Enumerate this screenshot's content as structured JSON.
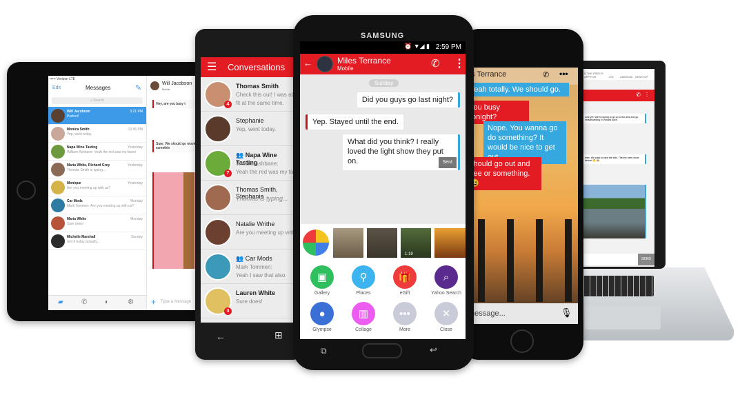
{
  "colors": {
    "brand_red": "#e31b23",
    "tablet_blue": "#3d9ae8",
    "sent_blue": "#35a8e0"
  },
  "tablet": {
    "status": "••••• Verizon  LTE",
    "edit": "Edit",
    "title": "Messages",
    "search_placeholder": "Search",
    "rows": [
      {
        "name": "Will Jacobson",
        "preview": "Perfect!",
        "time": "3:21 PM"
      },
      {
        "name": "Monica Smith",
        "preview": "Yep, went today.",
        "time": "12:45 PM"
      },
      {
        "name": "Napa Wine Tasting",
        "preview": "William Ashbane: Yeah the red was my favorite! From now on...",
        "time": "Yesterday"
      },
      {
        "name": "Maria White, Richard Grey",
        "preview": "Thomas Smith is typing...",
        "time": "Yesterday"
      },
      {
        "name": "Monique",
        "preview": "Are you meeting up with us?",
        "time": "Yesterday"
      },
      {
        "name": "Car Mods",
        "preview": "Mark Tommen: Are you meeting up with us?",
        "time": "Monday"
      },
      {
        "name": "Maria White",
        "preview": "Sure does!",
        "time": "Monday"
      },
      {
        "name": "Michelle Marshall",
        "preview": "Got it today actually...",
        "time": "Sunday"
      }
    ],
    "chat_name": "Will Jacobson",
    "chat_sub": "Mobile",
    "messages": [
      "Hey, are you busy t",
      "Sure. We should go movie or somethin"
    ],
    "input_placeholder": "Type a message"
  },
  "windows_phone": {
    "title": "Conversations",
    "rows": [
      {
        "name": "Thomas Smith",
        "lines": [
          "Check this out! I was able",
          "fit at the same time."
        ],
        "badge": "4",
        "bold": true
      },
      {
        "name": "Stephanie",
        "lines": [
          "Yep, went today."
        ],
        "bold": false
      },
      {
        "name": "Napa Wine Tasting",
        "lines": [
          "William Ashbane:",
          "Yeah the red was my favorite"
        ],
        "badge": "7",
        "bold": true,
        "group": true
      },
      {
        "name": "Thomas Smith, Stephanie",
        "lines": [
          "Thomas is typing..."
        ],
        "bold": false
      },
      {
        "name": "Natalie Writhe",
        "lines": [
          "Are you meeting up with us?"
        ],
        "bold": false
      },
      {
        "name": "Car Mods",
        "lines": [
          "Mark Tommen:",
          "Yeah I saw that also."
        ],
        "bold": false,
        "group": true
      },
      {
        "name": "Lauren White",
        "lines": [
          "Sure does!"
        ],
        "badge": "3",
        "bold": true
      }
    ]
  },
  "samsung": {
    "brand": "SAMSUNG",
    "time": "2:59 PM",
    "contact": "Miles Terrance",
    "contact_sub": "Mobile",
    "day": "Sunday",
    "messages": [
      {
        "dir": "out",
        "text": "Did you guys go last night?"
      },
      {
        "dir": "in",
        "text": "Yep. Stayed until the end."
      },
      {
        "dir": "out",
        "text": "What did you think? I really loved the light show they put on.",
        "status": "Sent"
      }
    ],
    "video_duration": "1:19",
    "actions": [
      {
        "label": "Gallery",
        "color": "#2fbf5f",
        "icon": "image-icon"
      },
      {
        "label": "Places",
        "color": "#3cb4ef",
        "icon": "map-pin-icon"
      },
      {
        "label": "eGift",
        "color": "#ee3b3b",
        "icon": "gift-icon"
      },
      {
        "label": "Yahoo Search",
        "color": "#5b2a8f",
        "icon": "search-icon"
      },
      {
        "label": "Glympse",
        "color": "#3a6fd6",
        "icon": "location-icon"
      },
      {
        "label": "Collage",
        "color": "#ec5cf0",
        "icon": "collage-icon"
      },
      {
        "label": "More",
        "color": "#c9cbd8",
        "icon": "more-icon"
      },
      {
        "label": "Close",
        "color": "#c9cbd8",
        "icon": "close-icon"
      }
    ]
  },
  "iphone": {
    "contact": "es Terrance",
    "messages": [
      {
        "dir": "out",
        "text": "Yeah totally. We should go."
      },
      {
        "dir": "in",
        "text": "you busy tonight?"
      },
      {
        "dir": "out",
        "text": "Nope. You wanna go do something? It would be nice to get out."
      },
      {
        "dir": "in",
        "text": "should go out and see or something. 😆"
      }
    ],
    "input_placeholder": "message..."
  },
  "laptop": {
    "promo": "D THE FREE R APP FOR",
    "platforms": [
      "iOS",
      "ANDROID",
      "DESKTOP"
    ],
    "messages": [
      "sure yet. We're hoping to go up to the ains and go snowboarding if it snows soon.",
      "then. We want to take the kids. They've seen snow before! 👶 🙈"
    ],
    "send": "SEND"
  }
}
